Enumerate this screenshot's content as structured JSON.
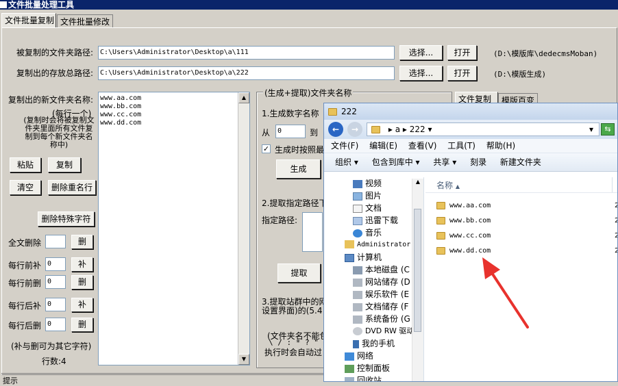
{
  "app": {
    "title": "文件批量处理工具"
  },
  "tabs": [
    "文件批量复制",
    "文件批量修改"
  ],
  "src": {
    "label": "被复制的文件夹路径:",
    "value": "C:\\Users\\Administrator\\Desktop\\a\\111",
    "choose": "选择...",
    "open": "打开",
    "note": "(D:\\模版库\\dedecmsMoban)"
  },
  "dst": {
    "label": "复制出的存放总路径:",
    "value": "C:\\Users\\Administrator\\Desktop\\a\\222",
    "choose": "选择...",
    "open": "打开",
    "note": "(D:\\模版生成)"
  },
  "left": {
    "label": "复制出的新文件夹名称:",
    "hint1": "(每行一个)",
    "hint2": "(复制时会将被复制文件夹里面所有文件复制到每个新文件夹名称中)",
    "paste": "粘贴",
    "copy": "复制",
    "clear": "清空",
    "dedupe": "删除重名行",
    "remove_special": "删除特殊字符",
    "global_del": "全文删除",
    "per_prefix_add": "每行前补",
    "per_prefix_del": "每行前删",
    "per_suffix_add": "每行后补",
    "per_suffix_del": "每行后删",
    "del_btn": "删",
    "add_btn": "补",
    "prefix_add_val": "0",
    "prefix_del_val": "0",
    "suffix_add_val": "0",
    "suffix_del_val": "0",
    "note": "(补与删可为其它字符)",
    "count": "行数:4"
  },
  "names": [
    "www.aa.com",
    "www.bb.com",
    "www.cc.com",
    "www.dd.com"
  ],
  "gen": {
    "group_title": "(生成+提取)文件夹名称",
    "s1": "1.生成数字名称",
    "from": "从",
    "from_val": "0",
    "to": "到",
    "keep_prefix": "生成时按照最",
    "gen_btn": "生成",
    "s2": "2.提取指定路径下",
    "path_lbl": "指定路径:",
    "extract_btn": "提取",
    "s3": "3.提取站群中的网",
    "s3b": "设置界面)的(5.4",
    "note1": "(文件夹名不能包",
    "note2": "\\ / : * ? \" <",
    "note3": "执行时会自动过"
  },
  "right_tabs": [
    "文件复制",
    "模版百变"
  ],
  "status": {
    "label": "提示"
  },
  "explorer": {
    "title": "222",
    "breadcrumb": [
      "a",
      "222"
    ],
    "menu": [
      "文件(F)",
      "编辑(E)",
      "查看(V)",
      "工具(T)",
      "帮助(H)"
    ],
    "toolbar": [
      "组织",
      "包含到库中",
      "共享",
      "刻录",
      "新建文件夹"
    ],
    "nav": [
      "视频",
      "图片",
      "文档",
      "迅雷下载",
      "音乐",
      "Administrator",
      "计算机",
      "本地磁盘 (C",
      "网站储存 (D",
      "娱乐软件 (E",
      "文档储存 (F",
      "系统备份 (G",
      "DVD RW 驱动",
      "我的手机",
      "网络",
      "控制面板",
      "回收站"
    ],
    "col_name": "名称",
    "files": [
      "www.aa.com",
      "www.bb.com",
      "www.cc.com",
      "www.dd.com"
    ],
    "file_col2": "2"
  },
  "colors": {
    "accent": "#0a246a",
    "arrow": "#e8322d"
  }
}
